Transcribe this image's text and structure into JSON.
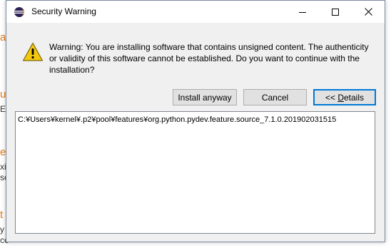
{
  "window": {
    "title": "Security Warning"
  },
  "title_buttons": {
    "minimize": "minimize-icon",
    "maximize": "maximize-icon",
    "close": "close-icon"
  },
  "message": "Warning: You are installing software that contains unsigned content. The authenticity or validity of this software cannot be established. Do you want to continue with the installation?",
  "buttons": {
    "install_anyway": "Install anyway",
    "cancel": "Cancel",
    "details_prefix": "<< ",
    "details_mnemonic": "D",
    "details_rest": "etails"
  },
  "details": {
    "lines": [
      "C:¥Users¥kernel¥.p2¥pool¥features¥org.python.pydev.feature.source_7.1.0.201902031515"
    ]
  },
  "background_fragments": [
    "a",
    "u",
    "E",
    "e",
    "xi",
    "se",
    "t",
    "y",
    "ce"
  ],
  "colors": {
    "accent": "#0078d7",
    "warning": "#f2c811"
  }
}
